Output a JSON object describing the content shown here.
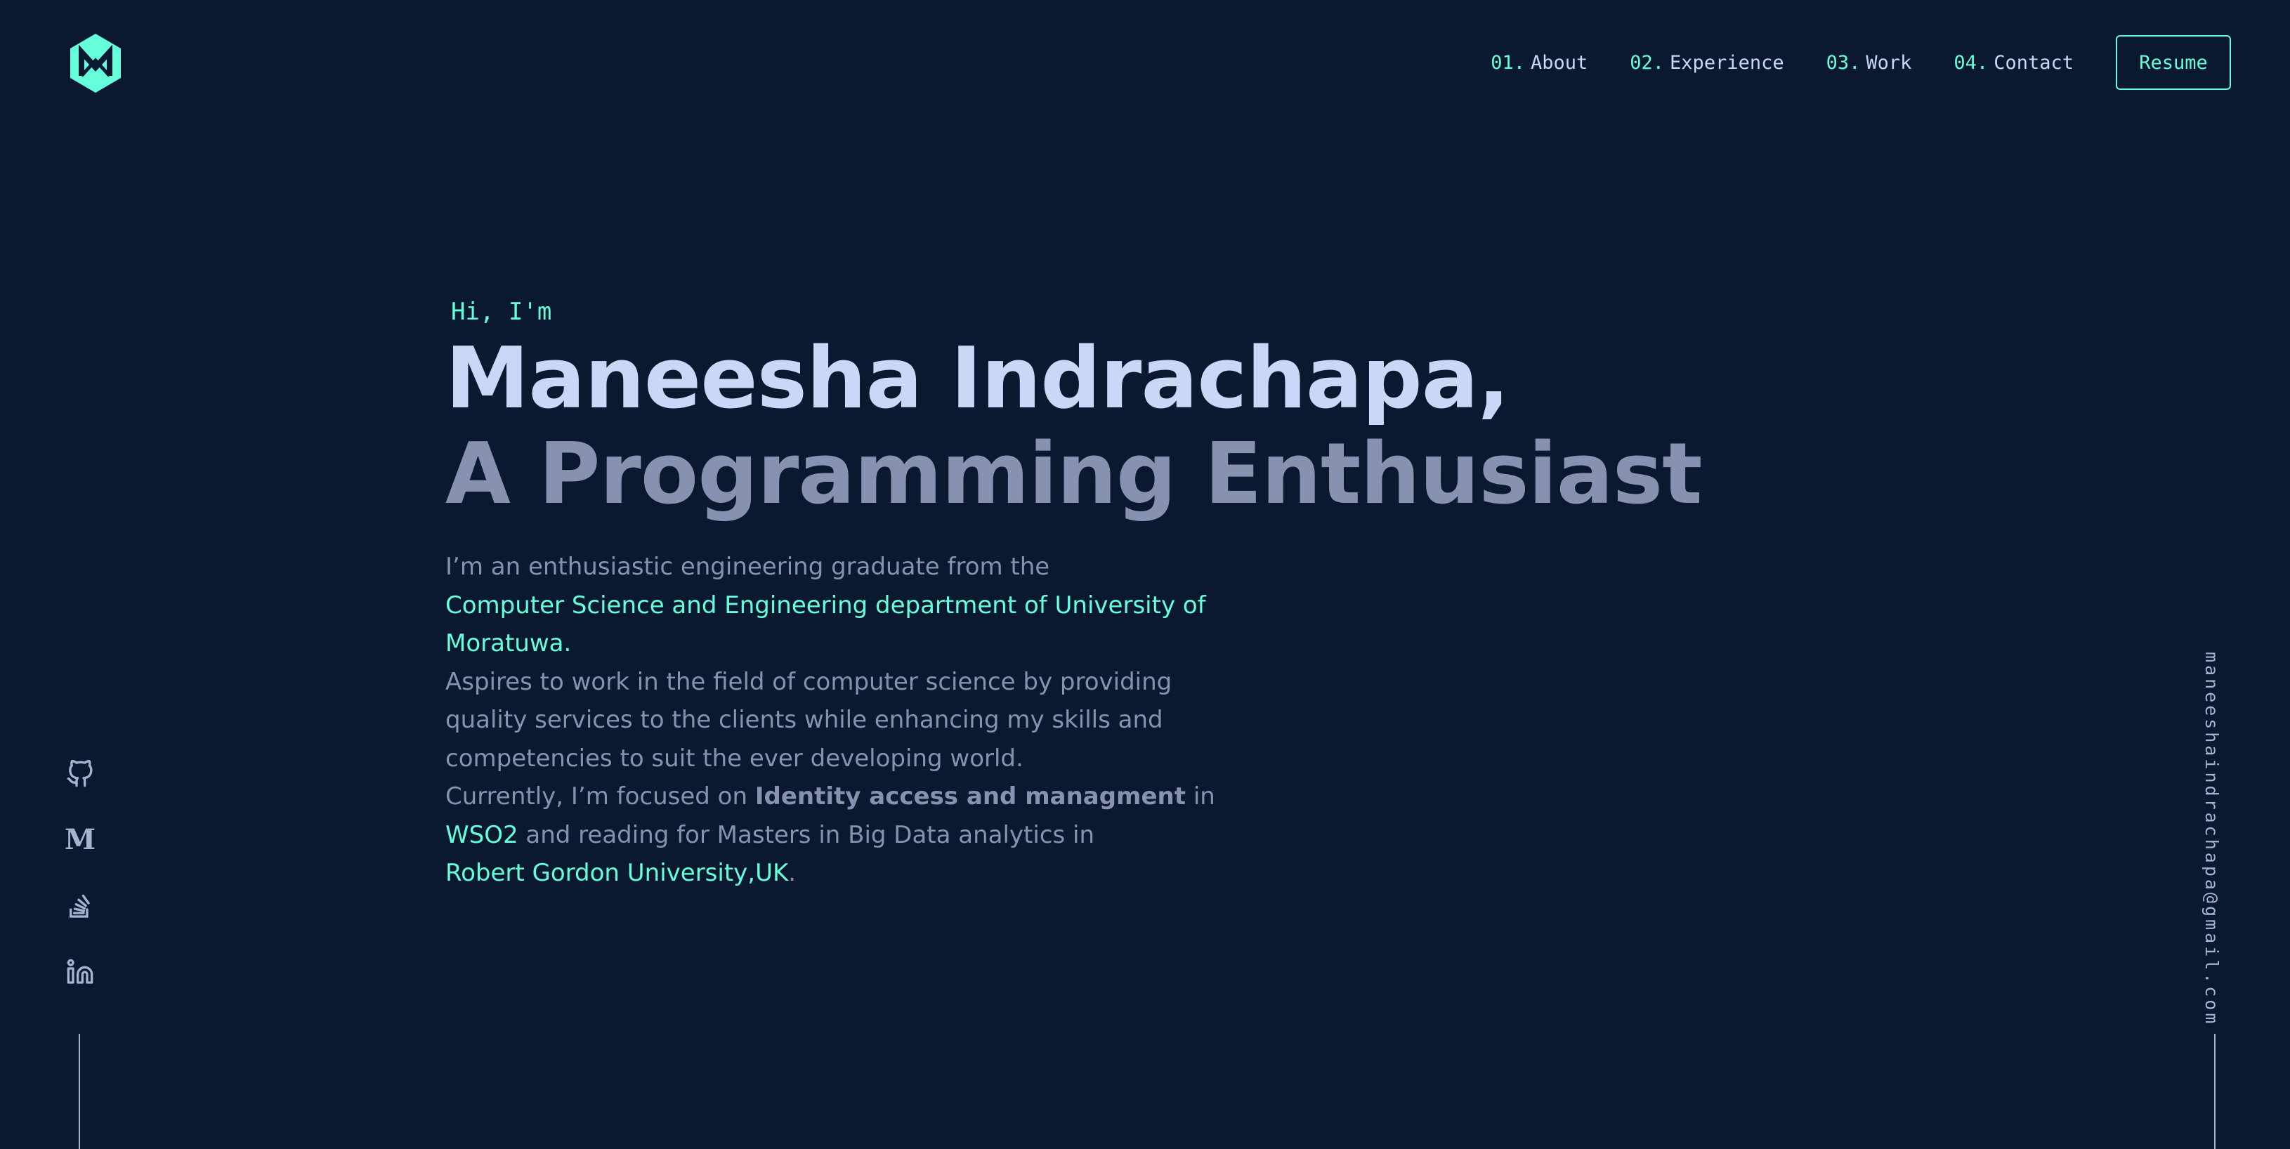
{
  "colors": {
    "background": "#0a192f",
    "accent": "#64ffda",
    "heading": "#ccd6f6",
    "text": "#8892b0"
  },
  "header": {
    "logo_icon": "hexagon-m-logo-icon",
    "nav": [
      {
        "num": "01.",
        "label": "About"
      },
      {
        "num": "02.",
        "label": "Experience"
      },
      {
        "num": "03.",
        "label": "Work"
      },
      {
        "num": "04.",
        "label": "Contact"
      }
    ],
    "resume_label": "Resume"
  },
  "hero": {
    "greeting": "Hi, I'm",
    "name": "Maneesha Indrachapa,",
    "tagline": "A Programming Enthusiast",
    "bio": {
      "l1": "I’m an enthusiastic engineering graduate from the",
      "l2": "Computer Science and Engineering department of University of",
      "l3": "Moratuwa.",
      "l4": "Aspires to work in the field of computer science by providing",
      "l5": "quality services to the clients while enhancing my skills and",
      "l6": "competencies to suit the ever developing world.",
      "l7a": "Currently, I’m focused on ",
      "l7b": "Identity access and managment",
      "l7c": " in",
      "l8a": "WSO2",
      "l8b": " and reading for Masters in Big Data analytics in",
      "l9a": "Robert Gordon University,UK",
      "l9b": "."
    }
  },
  "socials": [
    {
      "icon": "github-icon"
    },
    {
      "icon": "medium-icon",
      "glyph": "M"
    },
    {
      "icon": "stackoverflow-icon"
    },
    {
      "icon": "linkedin-icon"
    }
  ],
  "email": "maneeshaindrachapa@gmail.com"
}
